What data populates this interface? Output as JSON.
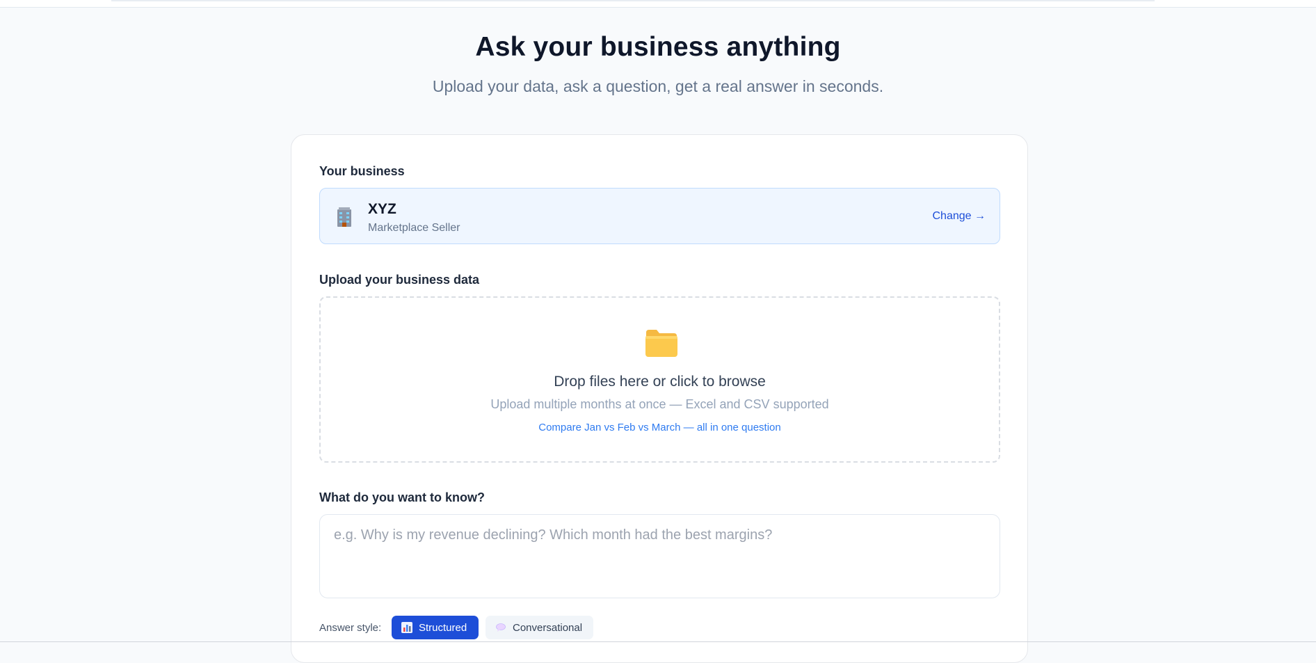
{
  "hero": {
    "title": "Ask your business anything",
    "subtitle": "Upload your data, ask a question, get a real answer in seconds."
  },
  "business": {
    "section_label": "Your business",
    "icon": "office-building-icon",
    "name": "XYZ",
    "type": "Marketplace Seller",
    "change_label": "Change →"
  },
  "upload": {
    "section_label": "Upload your business data",
    "icon": "folder-icon",
    "title": "Drop files here or click to browse",
    "subtitle": "Upload multiple months at once — Excel and CSV supported",
    "hint": "Compare Jan vs Feb vs March — all in one question"
  },
  "question": {
    "section_label": "What do you want to know?",
    "placeholder": "e.g. Why is my revenue declining? Which month had the best margins?",
    "value": ""
  },
  "answer_style": {
    "label": "Answer style:",
    "options": [
      {
        "label": "Structured",
        "icon": "bar-chart-icon",
        "selected": true
      },
      {
        "label": "Conversational",
        "icon": "speech-bubble-icon",
        "selected": false
      }
    ]
  },
  "colors": {
    "accent": "#1d4ed8",
    "link": "#2f7bf0",
    "business_box_bg": "#eff6ff",
    "page_bg": "#f8fafc"
  }
}
